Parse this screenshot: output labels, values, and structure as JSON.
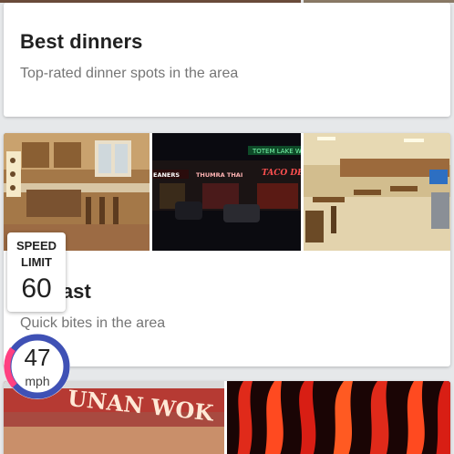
{
  "cards": [
    {
      "title": "Best dinners",
      "subtitle": "Top-rated dinner spots in the area"
    },
    {
      "title": "e it fast",
      "subtitle": "Quick bites in the area",
      "photos": [
        {
          "signs": []
        },
        {
          "signs": [
            "EANERS",
            "THUMRA THAI",
            "TOTEM LAKE W",
            "TACO DEL M"
          ]
        },
        {
          "signs": []
        }
      ]
    },
    {
      "photos": [
        {
          "signs": [
            "UNAN WOK"
          ]
        },
        {
          "signs": []
        }
      ]
    }
  ],
  "speed_limit": {
    "label_line1": "SPEED",
    "label_line2": "LIMIT",
    "value": "60"
  },
  "speedometer": {
    "value": "47",
    "unit": "mph"
  },
  "colors": {
    "card_bg": "#ffffff",
    "page_bg": "#e6e8ea",
    "ring_blue": "#3f51b5",
    "ring_pink": "#ff4081"
  }
}
